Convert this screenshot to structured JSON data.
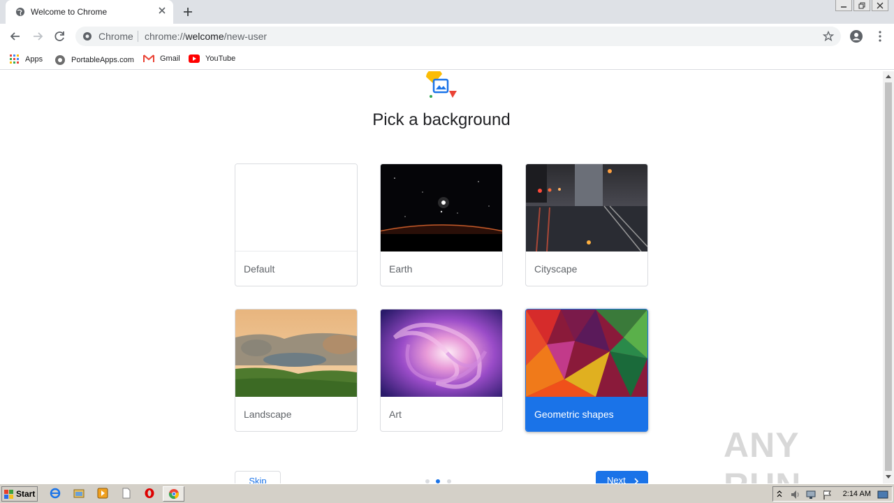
{
  "browser": {
    "tab_title": "Welcome to Chrome",
    "omnibox_chip": "Chrome",
    "url_prefix": "chrome://",
    "url_host": "welcome",
    "url_path": "/new-user"
  },
  "bookmarks": [
    {
      "label": "Apps",
      "icon": "apps-grid-icon"
    },
    {
      "label": "PortableApps.com",
      "icon": "portableapps-icon"
    },
    {
      "label": "Gmail",
      "icon": "gmail-icon"
    },
    {
      "label": "YouTube",
      "icon": "youtube-icon"
    }
  ],
  "page": {
    "heading": "Pick a background",
    "cards": [
      {
        "label": "Default"
      },
      {
        "label": "Earth"
      },
      {
        "label": "Cityscape"
      },
      {
        "label": "Landscape"
      },
      {
        "label": "Art"
      },
      {
        "label": "Geometric shapes",
        "selected": true
      }
    ],
    "skip_label": "Skip",
    "next_label": "Next"
  },
  "watermark": "ANY RUN",
  "taskbar": {
    "start_label": "Start",
    "clock": "2:14 AM"
  },
  "colors": {
    "accent": "#1a73e8"
  }
}
